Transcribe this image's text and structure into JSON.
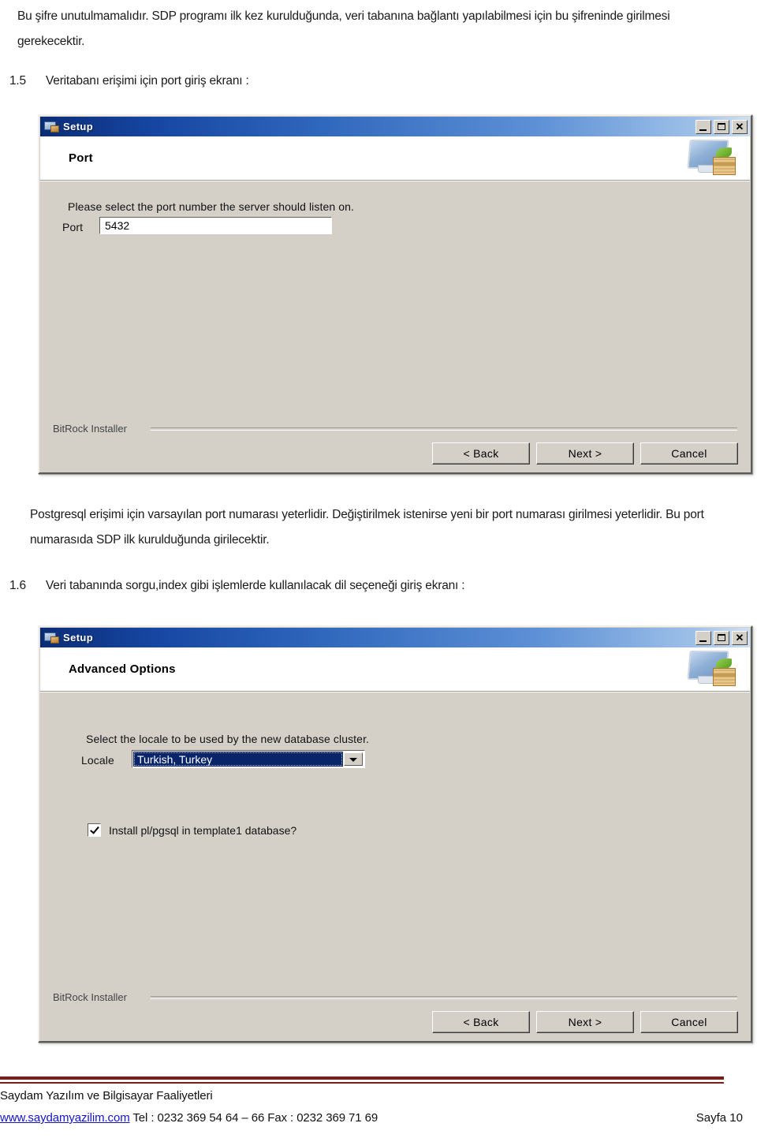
{
  "document": {
    "intro_paragraph": "Bu şifre unutulmamalıdır. SDP programı ilk kez kurulduğunda, veri tabanına bağlantı yapılabilmesi için bu şifreninde girilmesi gerekecektir.",
    "section_15_number": "1.5",
    "section_15_title": "Veritabanı erişimi için port giriş ekranı :",
    "middle_paragraph": "Postgresql erişimi için varsayılan port numarası yeterlidir. Değiştirilmek istenirse yeni bir port numarası girilmesi yeterlidir. Bu port numarasıda SDP ilk kurulduğunda girilecektir.",
    "section_16_number": "1.6",
    "section_16_title": "Veri tabanında sorgu,index gibi işlemlerde kullanılacak dil seçeneği giriş ekranı :"
  },
  "dialog_port": {
    "window_title": "Setup",
    "titlebar_icon": "setup-app-icon",
    "window_buttons": {
      "minimize": "minimize-icon",
      "maximize": "maximize-icon",
      "close": "close-icon"
    },
    "header_title": "Port",
    "header_icon": "bitrock-installer-icon",
    "prompt": "Please select the port number the server should listen on.",
    "field_label": "Port",
    "field_value": "5432",
    "footer_brand": "BitRock Installer",
    "buttons": {
      "back": "< Back",
      "next": "Next >",
      "cancel": "Cancel"
    }
  },
  "dialog_advanced": {
    "window_title": "Setup",
    "titlebar_icon": "setup-app-icon",
    "window_buttons": {
      "minimize": "minimize-icon",
      "maximize": "maximize-icon",
      "close": "close-icon"
    },
    "header_title": "Advanced Options",
    "header_icon": "bitrock-installer-icon",
    "prompt": "Select the locale to be used by the new database cluster.",
    "field_label": "Locale",
    "locale_selected": "Turkish, Turkey",
    "dropdown_icon": "chevron-down-icon",
    "checkbox_label": "Install pl/pgsql in template1 database?",
    "checkbox_checked": "check-icon",
    "footer_brand": "BitRock Installer",
    "buttons": {
      "back": "< Back",
      "next": "Next >",
      "cancel": "Cancel"
    }
  },
  "page_footer": {
    "company": "Saydam Yazılım ve Bilgisayar Faaliyetleri",
    "website": "www.saydamyazilim.com",
    "contact": " Tel  : 0232 369 54 64 – 66 Fax : 0232 369 71 69",
    "page_label": "Sayfa 10",
    "rule_color": "#7b1e17",
    "link_color": "#1414c8"
  }
}
